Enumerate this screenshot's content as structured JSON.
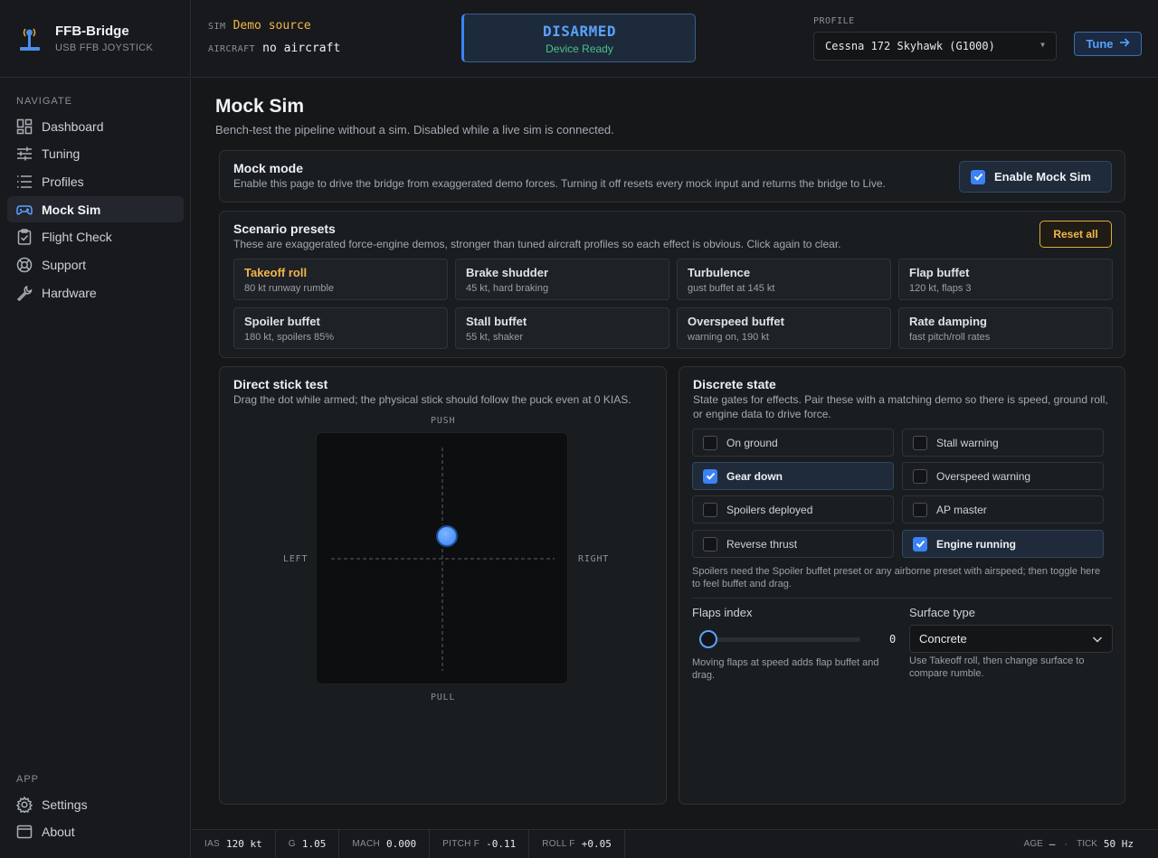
{
  "brand": {
    "title": "FFB-Bridge",
    "subtitle": "USB FFB JOYSTICK"
  },
  "sidebar": {
    "nav_heading": "NAVIGATE",
    "items": [
      {
        "label": "Dashboard",
        "icon": "dashboard-icon"
      },
      {
        "label": "Tuning",
        "icon": "sliders-icon"
      },
      {
        "label": "Profiles",
        "icon": "list-icon"
      },
      {
        "label": "Mock Sim",
        "icon": "gamepad-icon",
        "active": true
      },
      {
        "label": "Flight Check",
        "icon": "clipboard-check-icon"
      },
      {
        "label": "Support",
        "icon": "lifebuoy-icon"
      },
      {
        "label": "Hardware",
        "icon": "wrench-icon"
      }
    ],
    "app_heading": "APP",
    "app_items": [
      {
        "label": "Settings",
        "icon": "gear-icon"
      },
      {
        "label": "About",
        "icon": "window-icon"
      }
    ]
  },
  "topbar": {
    "sim_label": "SIM",
    "sim_value": "Demo source",
    "aircraft_label": "AIRCRAFT",
    "aircraft_value": "no aircraft",
    "arm_state": "DISARMED",
    "device_status": "Device Ready",
    "profile_label": "PROFILE",
    "profile_value": "Cessna 172 Skyhawk (G1000)",
    "tune_label": "Tune",
    "accent": "#3b82f6"
  },
  "main": {
    "title": "Mock Sim",
    "subtitle": "Bench-test the pipeline without a sim. Disabled while a live sim is connected.",
    "mock_mode": {
      "title": "Mock mode",
      "desc": "Enable this page to drive the bridge from exaggerated demo forces. Turning it off resets every mock input and returns the bridge to Live.",
      "toggle_label": "Enable Mock Sim",
      "enabled": true
    },
    "presets": {
      "title": "Scenario presets",
      "desc": "These are exaggerated force-engine demos, stronger than tuned aircraft profiles so each effect is obvious. Click again to clear.",
      "reset_label": "Reset all",
      "items": [
        {
          "name": "Takeoff roll",
          "detail": "80 kt runway rumble"
        },
        {
          "name": "Brake shudder",
          "detail": "45 kt, hard braking"
        },
        {
          "name": "Turbulence",
          "detail": "gust buffet at 145 kt"
        },
        {
          "name": "Flap buffet",
          "detail": "120 kt, flaps 3"
        },
        {
          "name": "Spoiler buffet",
          "detail": "180 kt, spoilers 85%"
        },
        {
          "name": "Stall buffet",
          "detail": "55 kt, shaker"
        },
        {
          "name": "Overspeed buffet",
          "detail": "warning on, 190 kt"
        },
        {
          "name": "Rate damping",
          "detail": "fast pitch/roll rates"
        }
      ]
    },
    "stick": {
      "title": "Direct stick test",
      "desc": "Drag the dot while armed; the physical stick should follow the puck even at 0 KIAS.",
      "push": "PUSH",
      "pull": "PULL",
      "left": "LEFT",
      "right": "RIGHT",
      "puck_x": 0.04,
      "puck_y": 0.2
    },
    "discrete": {
      "title": "Discrete state",
      "desc": "State gates for effects. Pair these with a matching demo so there is speed, ground roll, or engine data to drive force.",
      "items": [
        {
          "label": "On ground",
          "checked": false
        },
        {
          "label": "Stall warning",
          "checked": false
        },
        {
          "label": "Gear down",
          "checked": true
        },
        {
          "label": "Overspeed warning",
          "checked": false
        },
        {
          "label": "Spoilers deployed",
          "checked": false
        },
        {
          "label": "AP master",
          "checked": false
        },
        {
          "label": "Reverse thrust",
          "checked": false
        },
        {
          "label": "Engine running",
          "checked": true
        }
      ],
      "note": "Spoilers need the Spoiler buffet preset or any airborne preset with airspeed; then toggle here to feel buffet and drag.",
      "flaps_label": "Flaps index",
      "flaps_value": "0",
      "flaps_note": "Moving flaps at speed adds flap buffet and drag.",
      "surface_label": "Surface type",
      "surface_value": "Concrete",
      "surface_note": "Use Takeoff roll, then change surface to compare rumble."
    }
  },
  "statusbar": {
    "ias_label": "IAS",
    "ias_value": "120 kt",
    "g_label": "G",
    "g_value": "1.05",
    "mach_label": "MACH",
    "mach_value": "0.000",
    "pitch_label": "PITCH F",
    "pitch_value": "-0.11",
    "roll_label": "ROLL F",
    "roll_value": "+0.05",
    "age_label": "AGE",
    "age_value": "—",
    "sep": "·",
    "tick_label": "TICK",
    "tick_value": "50 Hz"
  }
}
